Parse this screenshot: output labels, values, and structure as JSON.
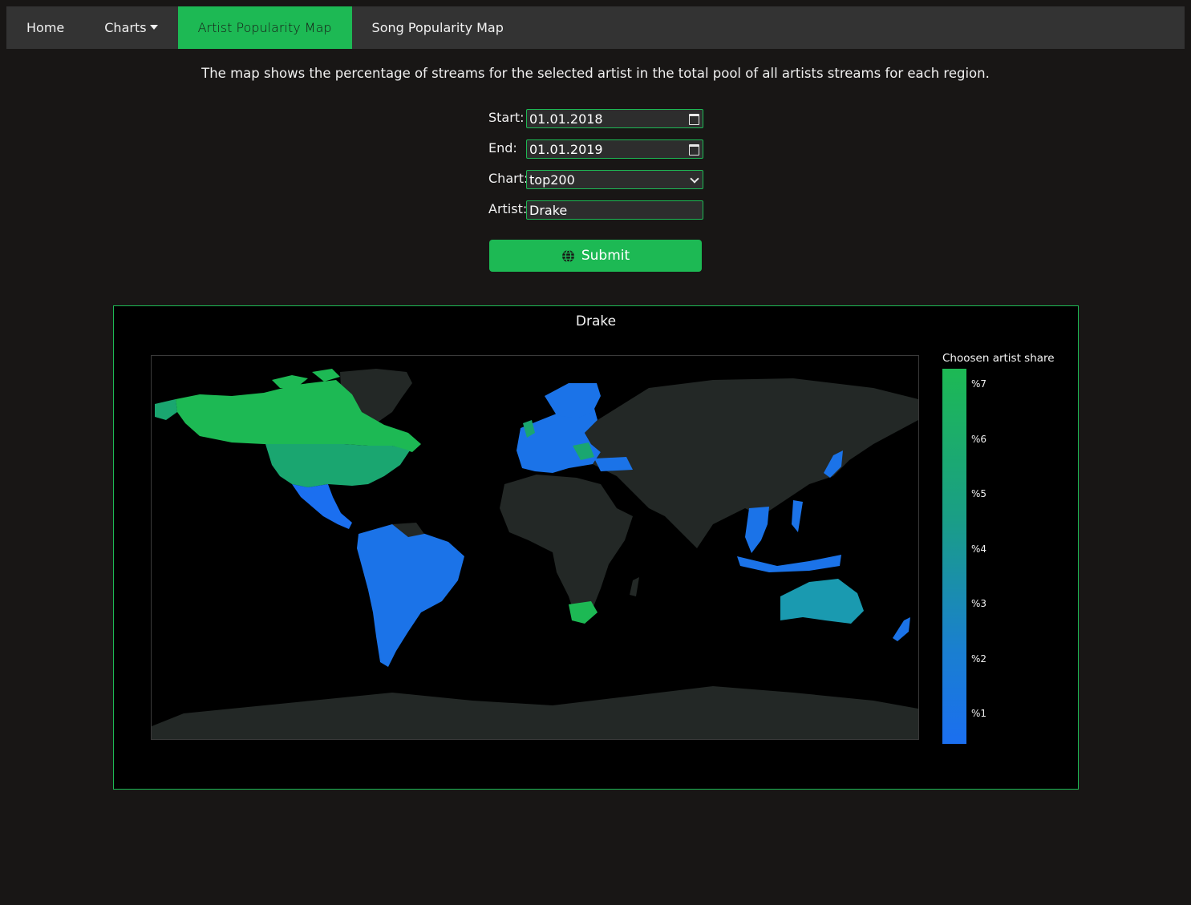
{
  "nav": {
    "items": [
      {
        "label": "Home"
      },
      {
        "label": "Charts"
      },
      {
        "label": "Artist Popularity Map"
      },
      {
        "label": "Song Popularity Map"
      }
    ]
  },
  "intro_text": "The map shows the percentage of streams for the selected artist in the total pool of all artists streams for each region.",
  "form": {
    "start_label": "Start:",
    "start_value": "01.01.2018",
    "end_label": "End:",
    "end_value": "01.01.2019",
    "chart_label": "Chart:",
    "chart_value": "top200",
    "artist_label": "Artist:",
    "artist_value": "Drake",
    "submit_label": "Submit",
    "submit_icon": "globe-icon"
  },
  "map": {
    "title": "Drake",
    "colorbar_title": "Choosen artist share",
    "colorbar_ticks": [
      "%7",
      "%6",
      "%5",
      "%4",
      "%3",
      "%2",
      "%1"
    ],
    "colors": {
      "high": "#1db954",
      "mid": "#1a9e86",
      "low": "#1b6ff0",
      "no_data": "#232826",
      "accent": "#1db954"
    },
    "regions": [
      {
        "name": "Canada",
        "share_level": "high"
      },
      {
        "name": "United States",
        "share_level": "high"
      },
      {
        "name": "South Africa",
        "share_level": "high"
      },
      {
        "name": "Australia",
        "share_level": "mid"
      },
      {
        "name": "Latin America",
        "share_level": "low"
      },
      {
        "name": "Europe",
        "share_level": "low"
      },
      {
        "name": "Southeast Asia",
        "share_level": "low"
      },
      {
        "name": "Japan",
        "share_level": "low"
      },
      {
        "name": "New Zealand",
        "share_level": "low"
      }
    ]
  }
}
